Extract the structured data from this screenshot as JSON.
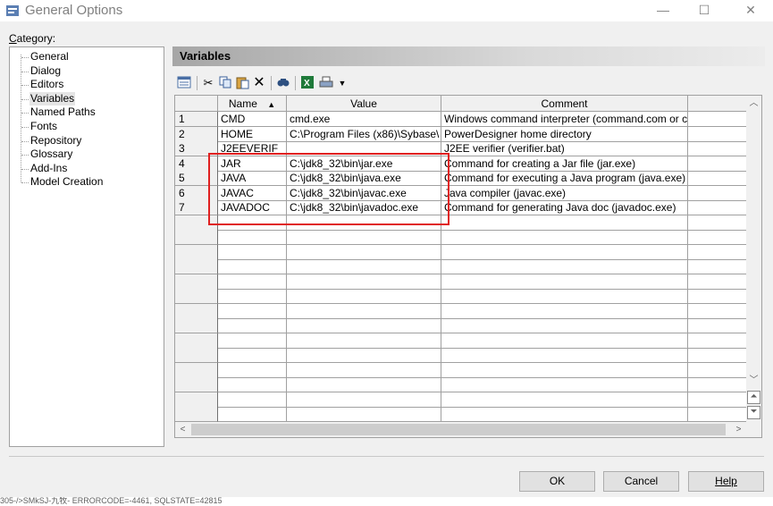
{
  "window": {
    "title": "General Options",
    "minimize": "—",
    "maximize": "☐",
    "close": "✕"
  },
  "category": {
    "label_prefix": "C",
    "label_rest": "ategory:",
    "items": [
      "General",
      "Dialog",
      "Editors",
      "Variables",
      "Named Paths",
      "Fonts",
      "Repository",
      "Glossary",
      "Add-Ins",
      "Model Creation"
    ],
    "selected": "Variables"
  },
  "panel": {
    "title": "Variables"
  },
  "toolbar": {
    "icons": [
      "properties-icon",
      "cut-icon",
      "copy-icon",
      "paste-icon",
      "delete-icon",
      "find-icon",
      "excel-icon",
      "print-icon",
      "dropdown-arrow-icon"
    ]
  },
  "grid": {
    "columns": {
      "name": "Name",
      "sort_indicator": "▲",
      "value": "Value",
      "comment": "Comment"
    },
    "rows": [
      {
        "num": "1",
        "name": "CMD",
        "value": "cmd.exe",
        "comment": "Windows command interpreter (command.com or c"
      },
      {
        "num": "2",
        "name": "HOME",
        "value": "C:\\Program Files (x86)\\Sybase\\",
        "comment": "PowerDesigner home directory"
      },
      {
        "num": "3",
        "name": "J2EEVERIF",
        "value": "",
        "comment": "J2EE verifier (verifier.bat)"
      },
      {
        "num": "4",
        "name": "JAR",
        "value": "C:\\jdk8_32\\bin\\jar.exe",
        "comment": "Command for creating a Jar file  (jar.exe)"
      },
      {
        "num": "5",
        "name": "JAVA",
        "value": "C:\\jdk8_32\\bin\\java.exe",
        "comment": "Command for executing a Java program (java.exe)"
      },
      {
        "num": "6",
        "name": "JAVAC",
        "value": "C:\\jdk8_32\\bin\\javac.exe",
        "comment": "Java compiler (javac.exe)"
      },
      {
        "num": "7",
        "name": "JAVADOC",
        "value": "C:\\jdk8_32\\bin\\javadoc.exe",
        "comment": "Command for generating Java doc (javadoc.exe)"
      }
    ],
    "empty_rows": 14
  },
  "buttons": {
    "ok": "OK",
    "cancel": "Cancel",
    "help": "Help"
  },
  "background_text": "305-/>SMkSJ-九牧-  ERRORCODE=-4461, SQLSTATE=42815",
  "colors": {
    "highlight_box": "#e02020"
  }
}
